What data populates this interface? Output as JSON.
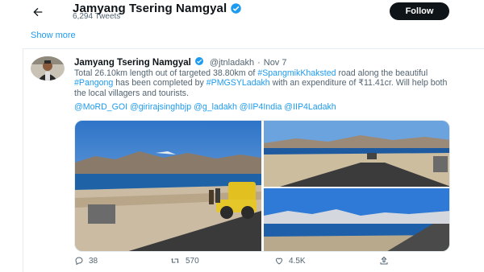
{
  "profile": {
    "name": "Jamyang Tsering Namgyal",
    "tweet_count": "6,294 Tweets",
    "follow_label": "Follow"
  },
  "bio": {
    "show_more": "Show more"
  },
  "tweet": {
    "author": "Jamyang Tsering Namgyal",
    "handle": "@jtnladakh",
    "separator": "·",
    "date": "Nov 7",
    "text_1": "Total 26.10km length out of targeted 38.80km of ",
    "hashtag_1": "#SpangmikKhaksted",
    "text_2": " road along the beautiful ",
    "hashtag_2": "#Pangong",
    "text_3": " has been completed by ",
    "hashtag_3": "#PMGSYLadakh",
    "text_4": " with an expenditure of ₹11.41cr. Will help both the local villagers and tourists.",
    "mentions": "@MoRD_GOI @girirajsinghbjp @g_ladakh @IIP4India @IIP4Ladakh"
  },
  "actions": {
    "reply_count": "38",
    "retweet_count": "570",
    "like_count": "4.5K"
  },
  "colors": {
    "accent": "#1d9bf0",
    "text": "#0f1419",
    "muted": "#536471"
  }
}
